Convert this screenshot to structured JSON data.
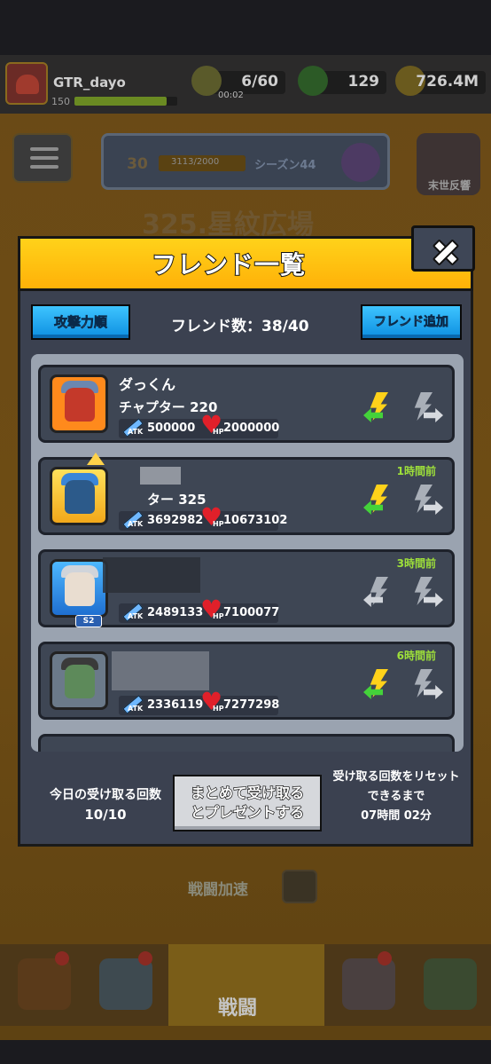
{
  "top_bar": {
    "player_name": "GTR_dayo",
    "player_level": "150",
    "xp_fraction": 0.9,
    "energy": "6/60",
    "energy_timer": "00:02",
    "gems": "129",
    "coins": "726.4M"
  },
  "season": {
    "level": "30",
    "progress": "3113/2000",
    "name": "シーズン44",
    "progress_fraction": 1.0
  },
  "event_button_label": "末世反響",
  "stage_title": "325.星紋広場",
  "battle_speed_label": "戦闘加速",
  "nav": {
    "battle_label": "戦闘"
  },
  "modal": {
    "title": "フレンド一覧",
    "sort_button": "攻撃力順",
    "friend_count": "フレンド数：38/40",
    "add_friend_button": "フレンド追加",
    "friends": [
      {
        "name": "ダっくん",
        "chapter": "チャプター 220",
        "atk": "500000",
        "hp": "2000000",
        "time": "",
        "gift_available": true
      },
      {
        "name": "",
        "chapter": "ター 325",
        "atk": "3692982",
        "hp": "10673102",
        "time": "1時間前",
        "gift_available": true
      },
      {
        "name": "",
        "chapter": "",
        "atk": "2489133",
        "hp": "7100077",
        "time": "3時間前",
        "gift_available": false
      },
      {
        "name": "",
        "chapter": "",
        "atk": "2336119",
        "hp": "7277298",
        "time": "6時間前",
        "gift_available": true
      }
    ],
    "labels": {
      "atk": "ATK",
      "hp": "HP",
      "s2": "S2"
    },
    "footer": {
      "today_label": "今日の受け取る回数",
      "today_value": "10/10",
      "claim_all_line1": "まとめて受け取る",
      "claim_all_line2": "とプレゼントする",
      "reset_line1": "受け取る回数をリセット",
      "reset_line2": "できるまで",
      "reset_time": "07時間 02分"
    }
  },
  "colors": {
    "header_yellow": "#ffc20f",
    "button_blue": "#1aa6f0",
    "time_green": "#9ee03a",
    "modal_body": "#3b4150"
  }
}
